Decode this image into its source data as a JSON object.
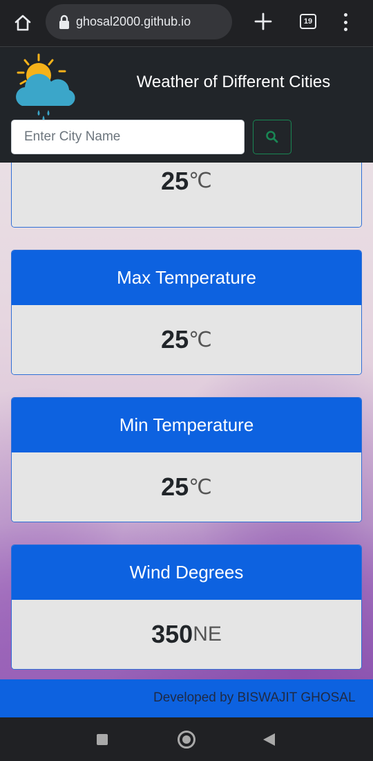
{
  "browser": {
    "url": "ghosal2000.github.io",
    "tab_count": "19"
  },
  "header": {
    "title": "Weather of Different Cities"
  },
  "search": {
    "placeholder": "Enter City Name",
    "value": ""
  },
  "cards": [
    {
      "title": "",
      "value": "25",
      "unit": "℃"
    },
    {
      "title": "Max Temperature",
      "value": "25",
      "unit": "℃"
    },
    {
      "title": "Min Temperature",
      "value": "25",
      "unit": "℃"
    },
    {
      "title": "Wind Degrees",
      "value": "350",
      "unit": "NE"
    }
  ],
  "footer": {
    "text": "Developed by BISWAJIT GHOSAL"
  },
  "colors": {
    "primary_blue": "#0d62e0",
    "header_dark": "#212529",
    "success_green": "#198754",
    "sun_yellow": "#f6b21a",
    "cloud_teal": "#3ba6c9"
  },
  "icons": [
    "home-icon",
    "lock-icon",
    "plus-icon",
    "more-vert-icon",
    "weather-logo-icon",
    "search-icon",
    "nav-recents-icon",
    "nav-home-icon",
    "nav-back-icon"
  ]
}
